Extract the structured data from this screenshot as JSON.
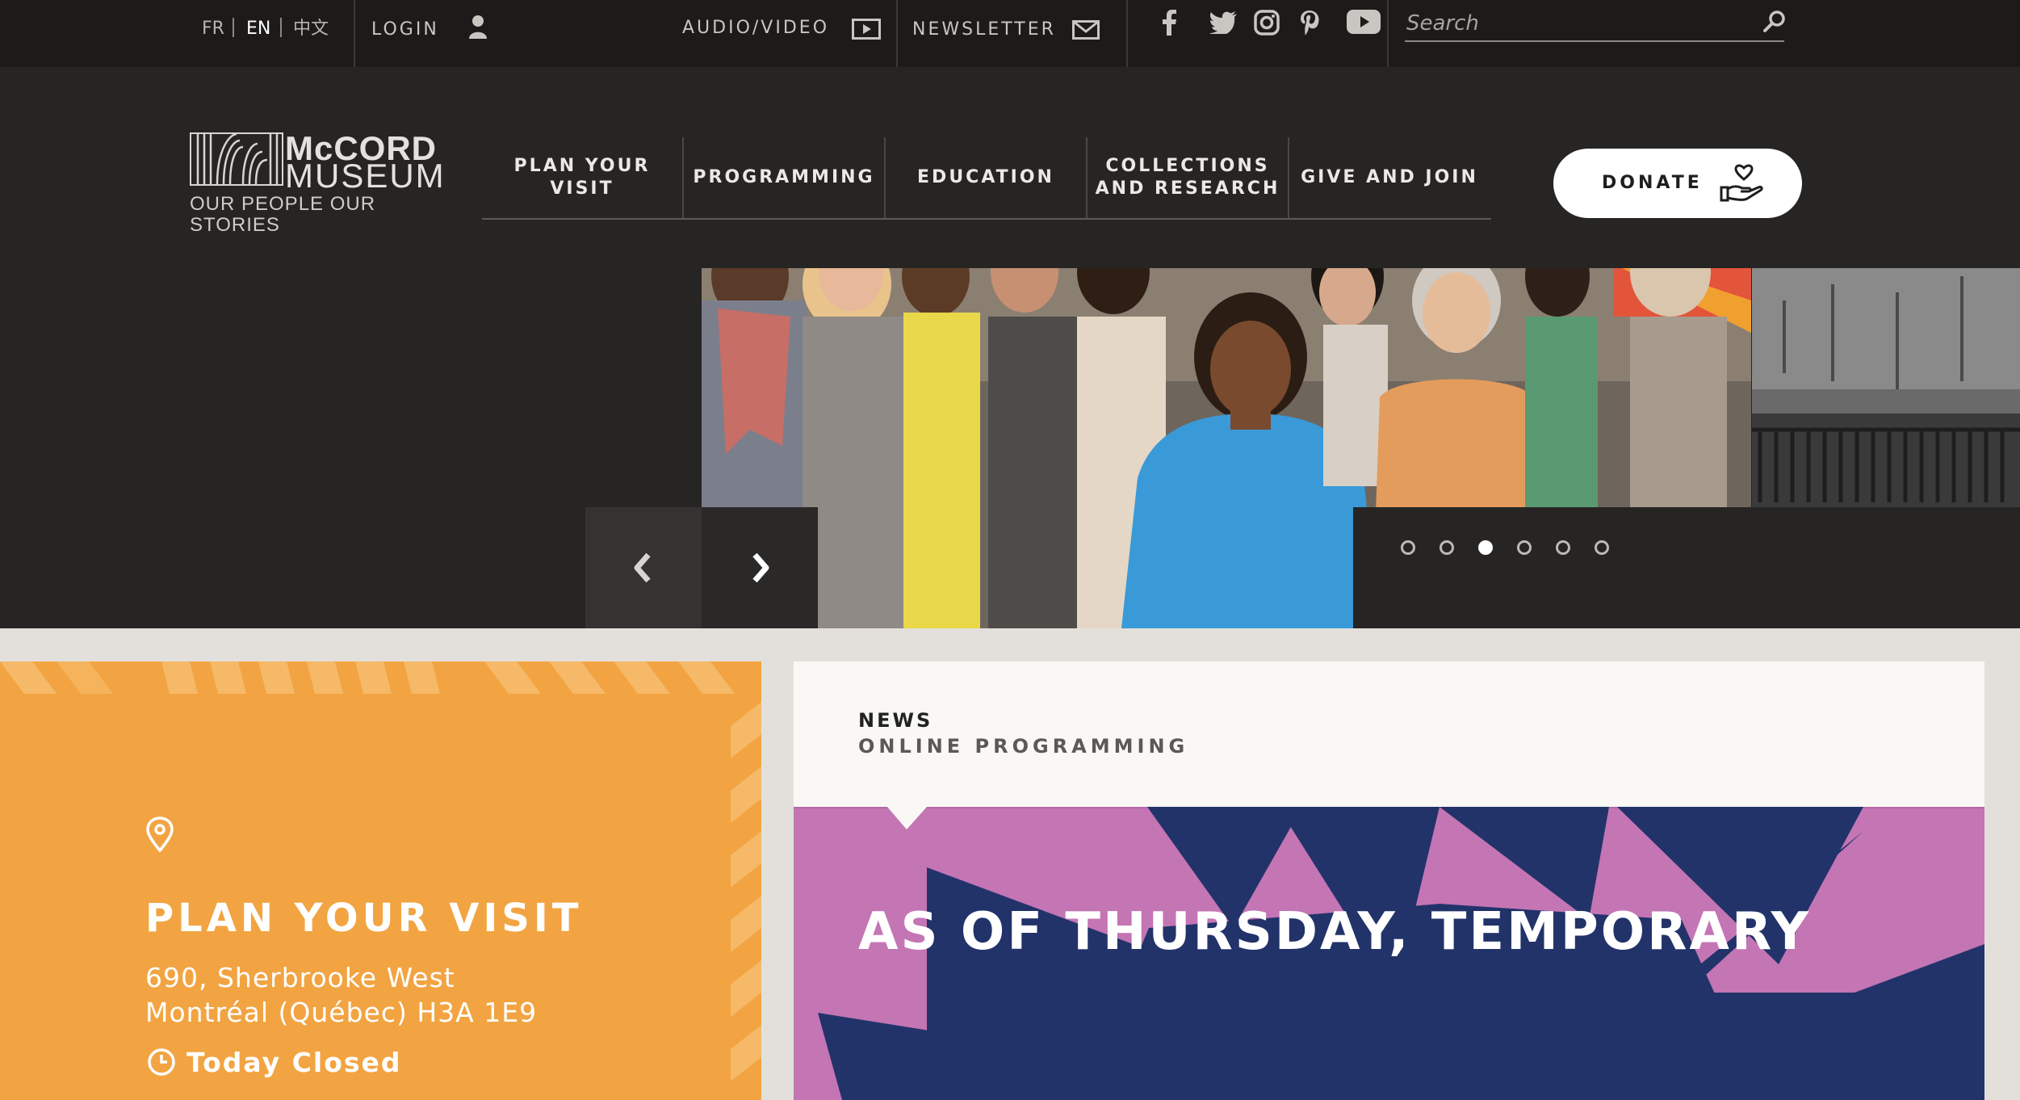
{
  "topbar": {
    "languages": [
      {
        "label": "FR",
        "active": false
      },
      {
        "label": "EN",
        "active": true
      },
      {
        "label": "中文",
        "active": false
      }
    ],
    "login_label": "LOGIN",
    "audio_video_label": "AUDIO/VIDEO",
    "newsletter_label": "NEWSLETTER",
    "social_icons": [
      "facebook-icon",
      "twitter-icon",
      "instagram-icon",
      "pinterest-icon",
      "youtube-icon"
    ],
    "search": {
      "placeholder": "Search",
      "value": ""
    }
  },
  "logo": {
    "line1": "McCORD",
    "line2": "MUSEUM",
    "tagline": "OUR PEOPLE OUR STORIES"
  },
  "nav": [
    {
      "label": "PLAN YOUR VISIT"
    },
    {
      "label": "PROGRAMMING"
    },
    {
      "label": "EDUCATION"
    },
    {
      "label": "COLLECTIONS\nAND RESEARCH"
    },
    {
      "label": "GIVE AND JOIN"
    }
  ],
  "donate": {
    "label": "DONATE"
  },
  "carousel": {
    "slide_count": 6,
    "active_index": 2
  },
  "visit": {
    "title": "PLAN YOUR VISIT",
    "address_line1": "690, Sherbrooke West",
    "address_line2": "Montréal (Québec) H3A 1E9",
    "hours": "Today Closed"
  },
  "news": {
    "kicker": "NEWS",
    "subkicker": "ONLINE PROGRAMMING",
    "headline": "AS OF THURSDAY, TEMPORARY"
  },
  "colors": {
    "topbar_bg": "#1c1b1a",
    "header_bg": "#262524",
    "accent_orange": "#f2a442",
    "news_purple": "#c475b4",
    "news_navy": "#22336a"
  }
}
